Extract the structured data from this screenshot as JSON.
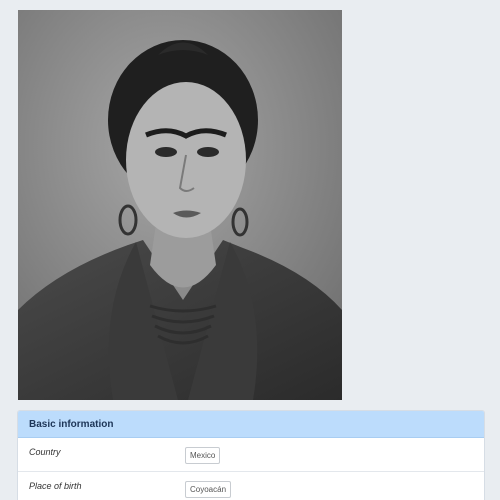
{
  "portrait": {
    "icon": "portrait-photo"
  },
  "basic_info": {
    "title": "Basic information",
    "rows": [
      {
        "label": "Country",
        "value": "Mexico"
      },
      {
        "label": "Place of birth",
        "value": "Coyoacán"
      }
    ]
  },
  "colors": {
    "page_bg": "#e9edf1",
    "header_bg": "#bcdcfc",
    "header_text": "#1d3557"
  }
}
